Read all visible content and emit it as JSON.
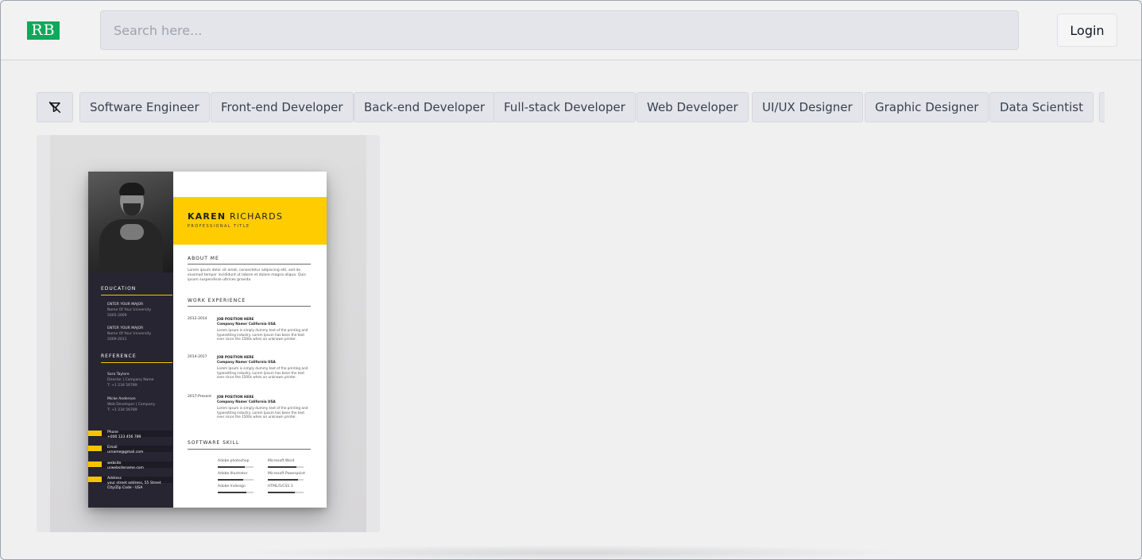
{
  "brand": {
    "logo_text": "RB",
    "logo_color": "#10a85a"
  },
  "header": {
    "search_placeholder": "Search here...",
    "login_label": "Login"
  },
  "filters": {
    "clear_icon": "filter-off-icon",
    "chips": [
      "Software Engineer",
      "Front-end Developer",
      "Back-end Developer",
      "Full-stack Developer",
      "Web Developer",
      "UI/UX Designer",
      "Graphic Designer",
      "Data Scientist"
    ]
  },
  "templates": [
    {
      "resume": {
        "first_name": "KAREN",
        "last_name": "RICHARDS",
        "title": "PROFESSIONAL TITLE",
        "accent_color": "#ffcc00",
        "side_color": "#272531",
        "sidebar": {
          "education_label": "EDUCATION",
          "education": [
            {
              "major": "ENTER YOUR MAJOR",
              "school": "Name Of Your University",
              "years": "2005-2009"
            },
            {
              "major": "ENTER YOUR MAJOR",
              "school": "Name Of Your University",
              "years": "2009-2011"
            }
          ],
          "reference_label": "REFERENCE",
          "references": [
            {
              "name": "Sara Taylore",
              "role": "Director | Company Name",
              "phone": "T: +1 234 56789"
            },
            {
              "name": "Micke Anderson",
              "role": "Web Developer | Company",
              "phone": "T: +1 234 56789"
            }
          ],
          "contacts": [
            {
              "label": "Phone",
              "value": "+000 123 456 789"
            },
            {
              "label": "Email",
              "value": "urname@gmail.com"
            },
            {
              "label": "website",
              "value": "urwebsitename.com"
            },
            {
              "label": "Address",
              "value": "your street address, 55 Street City/Zip Code - USA"
            }
          ]
        },
        "about_label": "ABOUT ME",
        "about_text": "Lorem ipsum dolor sit amet, consectetur adipiscing elit, sed do eiusmod tempor incididunt ut labore et dolore magna aliqua. Quis ipsum suspendisse ultrices gravida.",
        "work_label": "WORK EXPERIENCE",
        "work": [
          {
            "years": "2012-2014",
            "position": "JOB POSITION HERE",
            "company": "Company Name/ California USA",
            "desc": "Lorem Ipsum is simply dummy text of the printing and typesetting industry. Lorem Ipsum has been the text ever since the 1500s when an unknown printer."
          },
          {
            "years": "2014-2017",
            "position": "JOB POSITION HERE",
            "company": "Company Name/ California USA",
            "desc": "Lorem Ipsum is simply dummy text of the printing and typesetting industry. Lorem Ipsum has been the text ever since the 1500s when an unknown printer."
          },
          {
            "years": "2017-Present",
            "position": "JOB POSITION HERE",
            "company": "Company Name/ California USA",
            "desc": "Lorem Ipsum is simply dummy text of the printing and typesetting industry. Lorem Ipsum has been the text ever since the 1500s when an unknown printer."
          }
        ],
        "skills_label": "SOFTWARE SKILL",
        "skills": [
          {
            "name": "Adobe photoshop",
            "level": 0.75
          },
          {
            "name": "Microsoft Word",
            "level": 0.8
          },
          {
            "name": "Adobe Illustrator",
            "level": 0.7
          },
          {
            "name": "Microsoft Powerpoint",
            "level": 0.85
          },
          {
            "name": "Adobe Indesign",
            "level": 0.8
          },
          {
            "name": "HTML/5/CSS 3",
            "level": 0.75
          }
        ]
      }
    }
  ]
}
